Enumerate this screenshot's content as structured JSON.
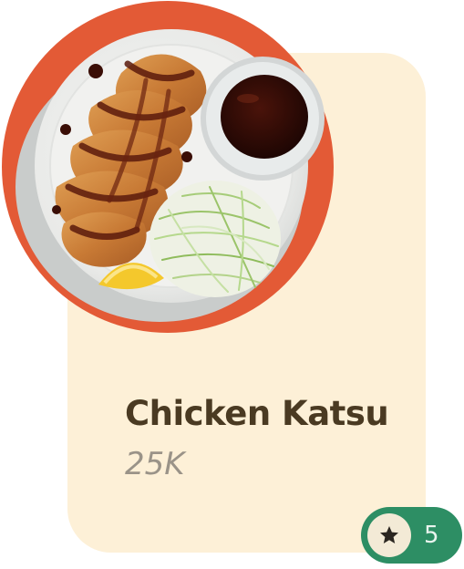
{
  "item": {
    "name": "Chicken Katsu",
    "price": "25K",
    "image_icon": "chicken-katsu-plate-image"
  },
  "rating": {
    "value": "5",
    "icon": "star-icon"
  },
  "colors": {
    "card_background": "#fdf0d7",
    "plate_ring": "#e35a36",
    "rating_pill": "#2d8e64",
    "title_text": "#4a3a22",
    "price_text": "#9a9388"
  }
}
